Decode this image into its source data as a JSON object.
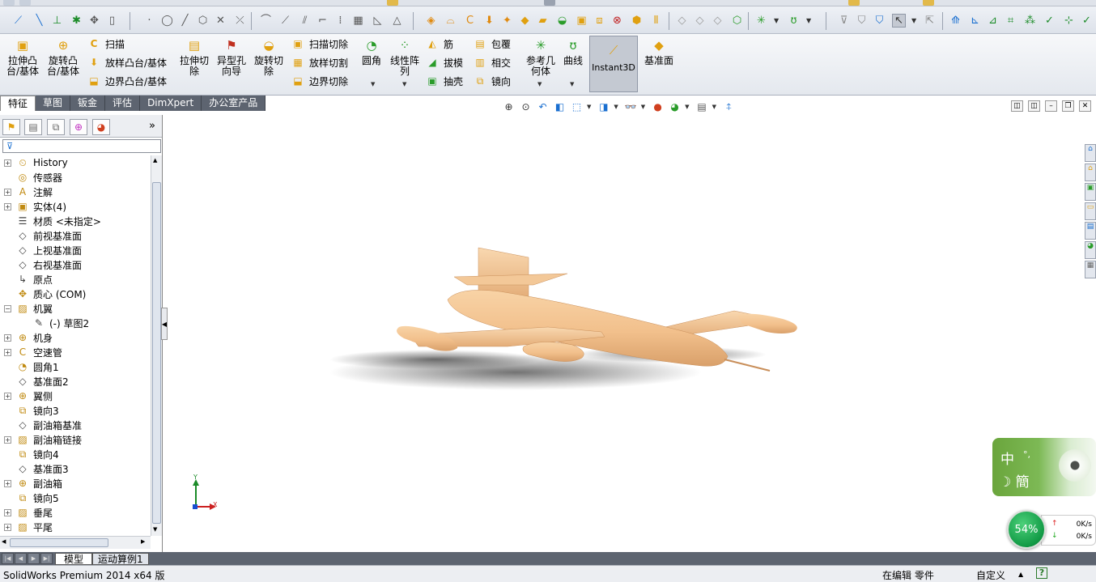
{
  "ribbon": {
    "extrude_boss": "拉伸凸\n台/基体",
    "revolve_boss": "旋转凸\n台/基体",
    "sweep": "扫描",
    "loft_boss": "放样凸台/基体",
    "boundary_boss": "边界凸台/基体",
    "extrude_cut": "拉伸切\n除",
    "hole_wizard": "异型孔\n向导",
    "revolve_cut": "旋转切\n除",
    "swept_cut": "扫描切除",
    "lofted_cut": "放样切割",
    "boundary_cut": "边界切除",
    "fillet": "圆角",
    "linear_pattern": "线性阵\n列",
    "rib": "筋",
    "draft": "拔模",
    "shell": "抽壳",
    "wrap": "包覆",
    "intersect": "相交",
    "mirror": "镜向",
    "ref_geometry": "参考几\n何体",
    "curves": "曲线",
    "instant3d": "Instant3D",
    "plane": "基准面"
  },
  "tabs": [
    "特征",
    "草图",
    "钣金",
    "评估",
    "DimXpert",
    "办公室产品"
  ],
  "tree": [
    {
      "label": "History",
      "icon": "history-icon",
      "glyph": "⏲",
      "exp": true
    },
    {
      "label": "传感器",
      "icon": "sensor-icon",
      "glyph": "◎",
      "exp": false
    },
    {
      "label": "注解",
      "icon": "annotation-icon",
      "glyph": "A",
      "exp": true
    },
    {
      "label": "实体(4)",
      "icon": "solid-bodies-icon",
      "glyph": "▣",
      "exp": true
    },
    {
      "label": "材质 <未指定>",
      "icon": "material-icon",
      "glyph": "☰",
      "exp": false
    },
    {
      "label": "前视基准面",
      "icon": "plane-icon",
      "glyph": "◇",
      "exp": false
    },
    {
      "label": "上视基准面",
      "icon": "plane-icon",
      "glyph": "◇",
      "exp": false
    },
    {
      "label": "右视基准面",
      "icon": "plane-icon",
      "glyph": "◇",
      "exp": false
    },
    {
      "label": "原点",
      "icon": "origin-icon",
      "glyph": "↳",
      "exp": false
    },
    {
      "label": "质心 (COM)",
      "icon": "center-of-mass-icon",
      "glyph": "✥",
      "exp": false
    },
    {
      "label": "机翼",
      "icon": "loft-feature-icon",
      "glyph": "▨",
      "exp": true,
      "open": true
    },
    {
      "label": "(-) 草图2",
      "icon": "sketch-icon",
      "glyph": "✎",
      "exp": false,
      "indent": true
    },
    {
      "label": "机身",
      "icon": "revolve-feature-icon",
      "glyph": "⊕",
      "exp": true
    },
    {
      "label": "空速管",
      "icon": "sweep-feature-icon",
      "glyph": "C",
      "exp": true
    },
    {
      "label": "圆角1",
      "icon": "fillet-feature-icon",
      "glyph": "◔",
      "exp": false
    },
    {
      "label": "基准面2",
      "icon": "plane-icon",
      "glyph": "◇",
      "exp": false
    },
    {
      "label": "翼侧",
      "icon": "revolve-feature-icon",
      "glyph": "⊕",
      "exp": true
    },
    {
      "label": "镜向3",
      "icon": "mirror-feature-icon",
      "glyph": "⧉",
      "exp": false
    },
    {
      "label": "副油箱基准",
      "icon": "plane-icon",
      "glyph": "◇",
      "exp": false
    },
    {
      "label": "副油箱链接",
      "icon": "loft-feature-icon",
      "glyph": "▨",
      "exp": true
    },
    {
      "label": "镜向4",
      "icon": "mirror-feature-icon",
      "glyph": "⧉",
      "exp": false
    },
    {
      "label": "基准面3",
      "icon": "plane-icon",
      "glyph": "◇",
      "exp": false
    },
    {
      "label": "副油箱",
      "icon": "revolve-feature-icon",
      "glyph": "⊕",
      "exp": true
    },
    {
      "label": "镜向5",
      "icon": "mirror-feature-icon",
      "glyph": "⧉",
      "exp": false
    },
    {
      "label": "垂尾",
      "icon": "loft-feature-icon",
      "glyph": "▨",
      "exp": true
    },
    {
      "label": "平尾",
      "icon": "loft-feature-icon",
      "glyph": "▨",
      "exp": true
    }
  ],
  "bottom_tabs": [
    "模型",
    "运动算例1"
  ],
  "status": {
    "app": "SolidWorks Premium 2014 x64 版",
    "editing": "在编辑 零件",
    "custom": "自定义",
    "help": "?"
  },
  "ime": {
    "char1": "中",
    "char2": "簡",
    "dot": "°,"
  },
  "net": {
    "percent": "54%",
    "up": "0K/s",
    "down": "0K/s"
  },
  "triad": {
    "x": "X",
    "y": "Y"
  },
  "colors": {
    "model": "#f2c595",
    "tab_dark": "#5d6470",
    "ime_green": "#76b34a"
  }
}
